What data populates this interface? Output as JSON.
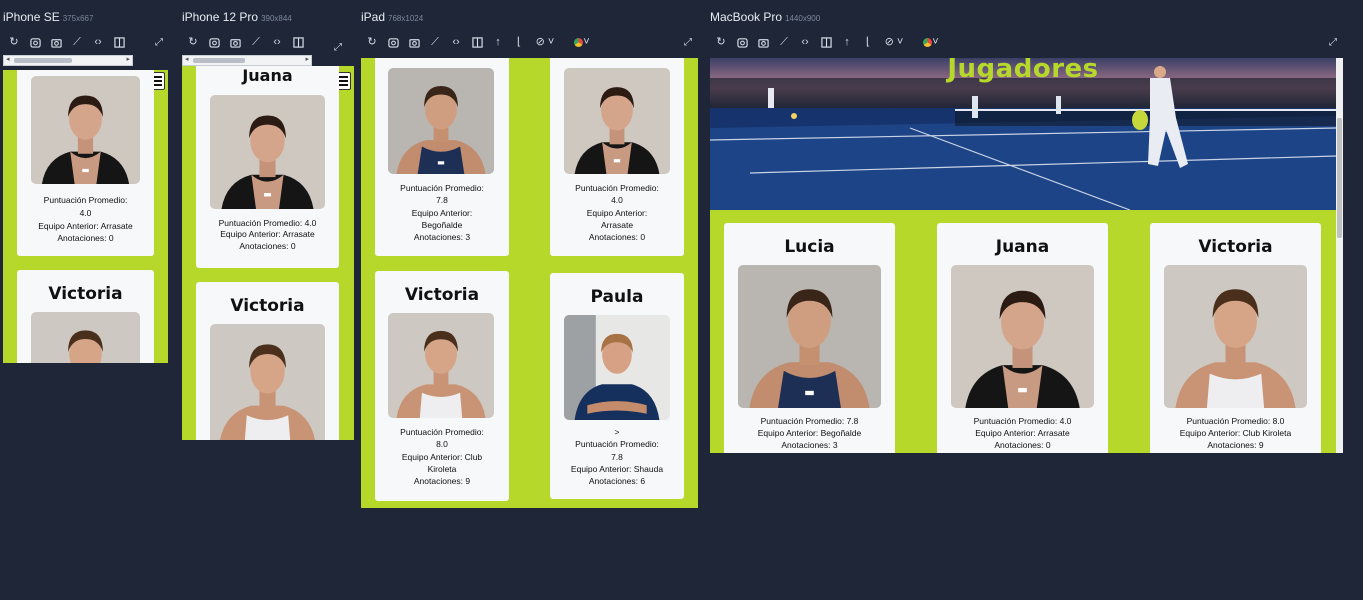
{
  "toolbar_icons": [
    "refresh-icon",
    "screenshot-icon",
    "camera-icon",
    "ruler-icon",
    "code-icon",
    "layout-icon",
    "scroll-up-icon",
    "frame-icon",
    "hide-icon",
    "theme-icon",
    "fullscreen-icon"
  ],
  "colors": {
    "background": "#1e2637",
    "accent": "#b5d82a",
    "card": "#f7f8fa"
  },
  "devices": [
    {
      "name": "iPhone SE",
      "size": "375x667"
    },
    {
      "name": "iPhone 12 Pro",
      "size": "390x844"
    },
    {
      "name": "iPad",
      "size": "768x1024"
    },
    {
      "name": "MacBook Pro",
      "size": "1440x900"
    }
  ],
  "hero_title": "Jugadores",
  "labels": {
    "avg": "Puntuación Promedio:",
    "team": "Equipo Anterior:",
    "notes": "Anotaciones:"
  },
  "players": {
    "lucia": {
      "name": "Lucia",
      "avg": "7.8",
      "team": "Begoñalde",
      "notes": "3"
    },
    "juana": {
      "name": "Juana",
      "avg": "4.0",
      "team": "Arrasate",
      "notes": "0"
    },
    "victoria": {
      "name": "Victoria",
      "avg": "8.0",
      "team": "Club Kiroleta",
      "notes": "9"
    },
    "paula": {
      "name": "Paula",
      "avg": "7.8",
      "team": "Shauda",
      "notes": "6",
      "stray": ">"
    }
  },
  "texts": {
    "avg_juana_full": "Puntuación Promedio: 4.0",
    "team_juana_full": "Equipo Anterior: Arrasate",
    "notes_juana_full": "Anotaciones: 0",
    "team_juana_cut": "Equipo Anterior:",
    "notes_lucia_full": "Anotaciones: 3",
    "team_lucia_full": "Equipo Anterior: Begoñalde",
    "avg_lucia_full": "Puntuación Promedio: 7.8",
    "avg_victoria_full": "Puntuación Promedio: 8.0",
    "team_victoria_full": "Equipo Anterior: Club Kiroleta",
    "notes_victoria_full": "Anotaciones: 9",
    "team_victoria_cut": "Equipo Anterior: Club",
    "team_paula_full": "Equipo Anterior: Shauda",
    "notes_paula_full": "Anotaciones: 6"
  }
}
